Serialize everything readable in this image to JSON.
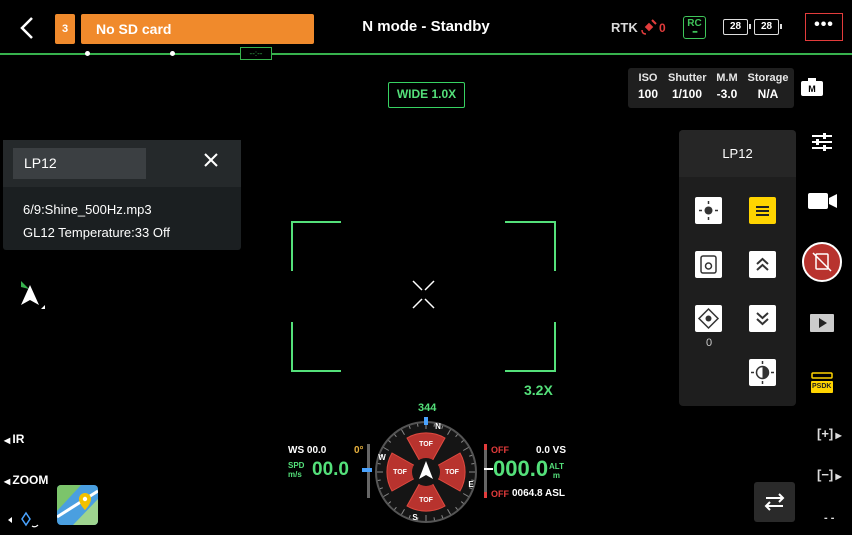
{
  "topbar": {
    "sd_badge": "3",
    "sd_message": "No SD card",
    "mode": "N mode - Standby",
    "rtk_label": "RTK",
    "rtk_count": "0",
    "rc_label": "RC",
    "battery_1": "28",
    "battery_2": "28",
    "more": "•••",
    "timeline_marker": "--:--"
  },
  "lens": {
    "label": "WIDE  1.0X"
  },
  "camera_params": [
    {
      "label": "ISO",
      "value": "100"
    },
    {
      "label": "Shutter",
      "value": "1/100"
    },
    {
      "label": "M.M",
      "value": "-3.0"
    },
    {
      "label": "Storage",
      "value": "N/A"
    }
  ],
  "camera_mode_badge": "M",
  "lp_panel": {
    "input_value": "LP12",
    "line1": "6/9:Shine_500Hz.mp3",
    "line2": "GL12 Temperature:33 Off"
  },
  "zoom_factor": "3.2X",
  "right_panel": {
    "title": "LP12",
    "zero_value": "0"
  },
  "psdk_label": "PSDK",
  "bottom_left": {
    "ir_label": "IR",
    "zoom_label": "ZOOM"
  },
  "flight": {
    "ws": "WS 00.0",
    "ws_deg": "0°",
    "spd_unit_top": "SPD",
    "spd_unit_bottom": "m/s",
    "spd_value": "00.0",
    "heading": "344",
    "off_top": "OFF",
    "vs": "0.0 VS",
    "alt_value": "000.0",
    "alt_unit_top": "ALT",
    "alt_unit_bottom": "m",
    "off_bottom": "OFF",
    "asl": "0064.8 ASL",
    "tof": "TOF",
    "compass_n": "N",
    "compass_e": "E",
    "compass_s": "S",
    "compass_w": "W"
  },
  "right_controls": {
    "plus": "[+]",
    "minus": "[−]",
    "dashes": "- -"
  },
  "colors": {
    "accent_green": "#54e07a",
    "warning_orange": "#f08a2c",
    "alert_red": "#e33c3c",
    "tof_red": "#b8332e"
  }
}
